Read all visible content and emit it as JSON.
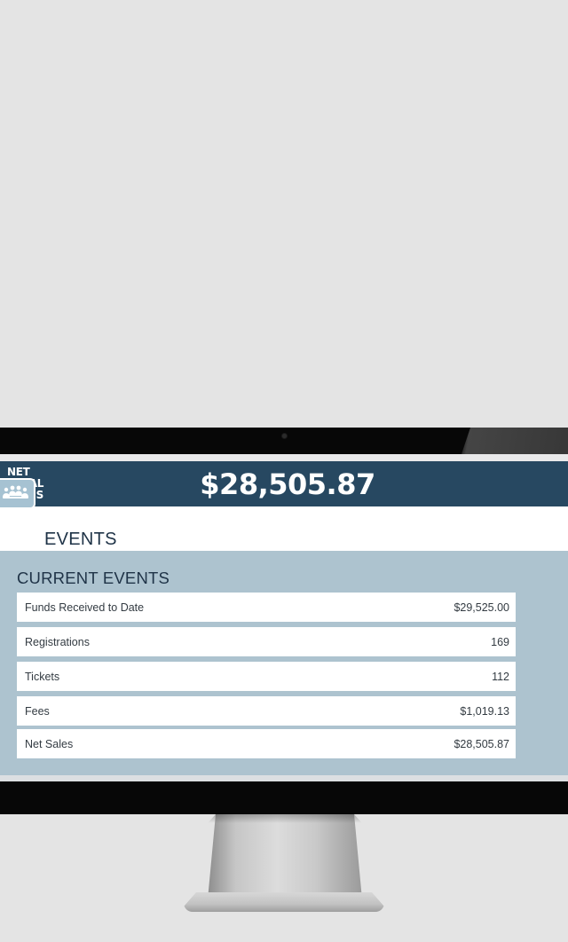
{
  "net_sales_label": [
    "NET",
    "TOTAL",
    "SALES"
  ],
  "net_sales_amount": "$28,505.87",
  "section": {
    "title": "EVENTS",
    "icon": "people-group-icon"
  },
  "current_events": {
    "title": "CURRENT EVENTS",
    "rows": [
      {
        "label": "Funds Received to Date",
        "value": "$29,525.00"
      },
      {
        "label": "Registrations",
        "value": "169"
      },
      {
        "label": "Tickets",
        "value": "112"
      },
      {
        "label": "Fees",
        "value": "$1,019.13"
      },
      {
        "label": "Net Sales",
        "value": "$28,505.87"
      }
    ]
  },
  "colors": {
    "header_bar": "#274861",
    "panel": "#adc3cf",
    "title_text": "#1f3347"
  }
}
